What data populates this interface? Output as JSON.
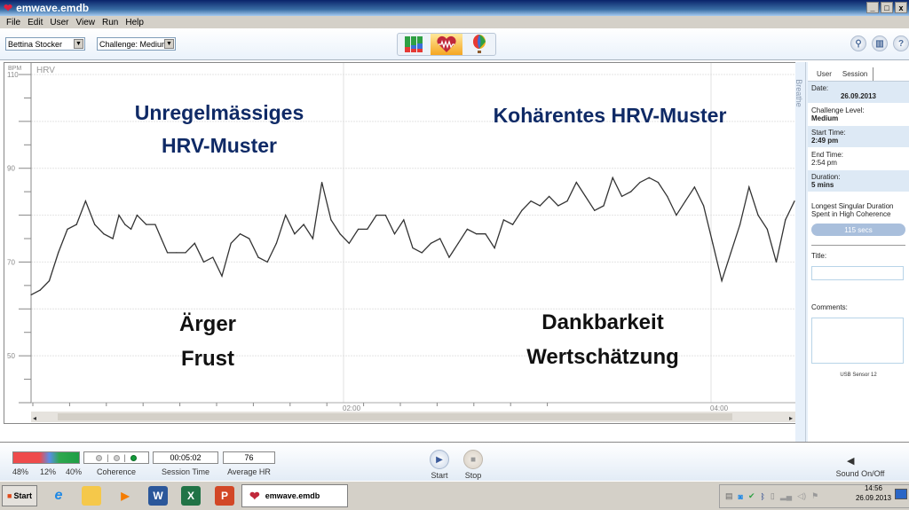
{
  "window": {
    "title": "emwave.emdb",
    "buttons": [
      "_",
      "□",
      "x"
    ]
  },
  "menu": [
    "File",
    "Edit",
    "User",
    "View",
    "Run",
    "Help"
  ],
  "toolbar": {
    "user_select": "Bettina Stocker",
    "challenge_select": "Challenge: Medium",
    "view_buttons": [
      {
        "name": "bar-chart-view",
        "active": false
      },
      {
        "name": "heart-hrv-view",
        "active": true
      },
      {
        "name": "balloon-game-view",
        "active": false
      }
    ],
    "right_icons": [
      "search-icon",
      "book-icon",
      "help-icon"
    ]
  },
  "chart_data": {
    "type": "line",
    "title": "HRV",
    "ylabel": "BPM",
    "ylim": [
      40,
      110
    ],
    "yticks_labeled": [
      50,
      70,
      90,
      110
    ],
    "x_ticks": [
      "02:00",
      "04:00"
    ],
    "grid": true,
    "series": [
      {
        "name": "HRV",
        "x_minutes": [
          0.0,
          0.06,
          0.12,
          0.18,
          0.24,
          0.3,
          0.36,
          0.42,
          0.48,
          0.54,
          0.58,
          0.62,
          0.66,
          0.7,
          0.76,
          0.82,
          0.86,
          0.9,
          0.96,
          1.02,
          1.08,
          1.14,
          1.2,
          1.26,
          1.32,
          1.38,
          1.44,
          1.5,
          1.56,
          1.62,
          1.68,
          1.74,
          1.8,
          1.86,
          1.92,
          1.98,
          2.04,
          2.1,
          2.16,
          2.22,
          2.28,
          2.34,
          2.4,
          2.46,
          2.52,
          2.58,
          2.64,
          2.7,
          2.76,
          2.82,
          2.88,
          2.94,
          3.0,
          3.06,
          3.12,
          3.18,
          3.24,
          3.3,
          3.36,
          3.42,
          3.48,
          3.54,
          3.6,
          3.66,
          3.72,
          3.78,
          3.84,
          3.9,
          3.96,
          4.02,
          4.08,
          4.14,
          4.2,
          4.26,
          4.32,
          4.38,
          4.44,
          4.5,
          4.56,
          4.62,
          4.68,
          4.74,
          4.8,
          4.86,
          4.92,
          4.98,
          5.04
        ],
        "bpm": [
          63,
          64,
          66,
          72,
          77,
          78,
          83,
          78,
          76,
          75,
          80,
          78,
          77,
          80,
          78,
          78,
          75,
          72,
          72,
          72,
          74,
          70,
          71,
          67,
          74,
          76,
          75,
          71,
          70,
          74,
          80,
          76,
          78,
          75,
          87,
          79,
          76,
          74,
          77,
          77,
          80,
          80,
          76,
          79,
          73,
          72,
          74,
          75,
          71,
          74,
          77,
          76,
          76,
          73,
          79,
          78,
          81,
          83,
          82,
          84,
          82,
          83,
          87,
          84,
          81,
          82,
          88,
          84,
          85,
          87,
          88,
          87,
          84,
          80,
          83,
          86,
          82,
          74,
          66,
          72,
          78,
          86,
          80,
          77,
          70,
          79,
          83
        ]
      }
    ],
    "annotations": [
      {
        "text_lines": [
          "Unregelmässiges",
          "HRV-Muster"
        ],
        "color": "#0f2a66"
      },
      {
        "text_lines": [
          "Kohärentes HRV-Muster"
        ],
        "color": "#0f2a66"
      },
      {
        "text_lines": [
          "Ärger",
          "Frust"
        ],
        "color": "#111111"
      },
      {
        "text_lines": [
          "Dankbarkeit",
          "Wertschätzung"
        ],
        "color": "#111111"
      }
    ]
  },
  "side_panel": {
    "breathe_label": "Breathe",
    "tabs": [
      {
        "label": "User",
        "active": false
      },
      {
        "label": "Session",
        "active": true
      }
    ],
    "items": [
      {
        "label": "Date:",
        "value": "26.09.2013"
      },
      {
        "label": "Challenge Level:",
        "value": "Medium"
      },
      {
        "label": "Start Time:",
        "value": "2:49 pm"
      },
      {
        "label": "End Time:",
        "value": "2:54 pm"
      },
      {
        "label": "Duration:",
        "value": "5 mins"
      }
    ],
    "longest_label": "Longest Singular Duration Spent in High Coherence",
    "longest_value": "115 secs",
    "title_label": "Title:",
    "title_value": "",
    "comments_label": "Comments:",
    "comments_value": "",
    "sensor": "USB Sensor 12"
  },
  "status": {
    "coherence_pct": {
      "low": "48%",
      "medium": "12%",
      "high": "40%"
    },
    "coherence_label": "Coherence",
    "session_time": "00:05:02",
    "session_time_label": "Session Time",
    "average_hr": "76",
    "average_hr_label": "Average HR",
    "start_label": "Start",
    "stop_label": "Stop",
    "sound_label": "Sound On/Off"
  },
  "taskbar": {
    "start_label": "Start",
    "pinned": [
      "internet-explorer-icon",
      "file-explorer-icon",
      "media-player-icon",
      "word-icon",
      "excel-icon",
      "powerpoint-icon"
    ],
    "active_app": "emwave.emdb",
    "clock_time": "14:56",
    "clock_date": "26.09.2013"
  }
}
